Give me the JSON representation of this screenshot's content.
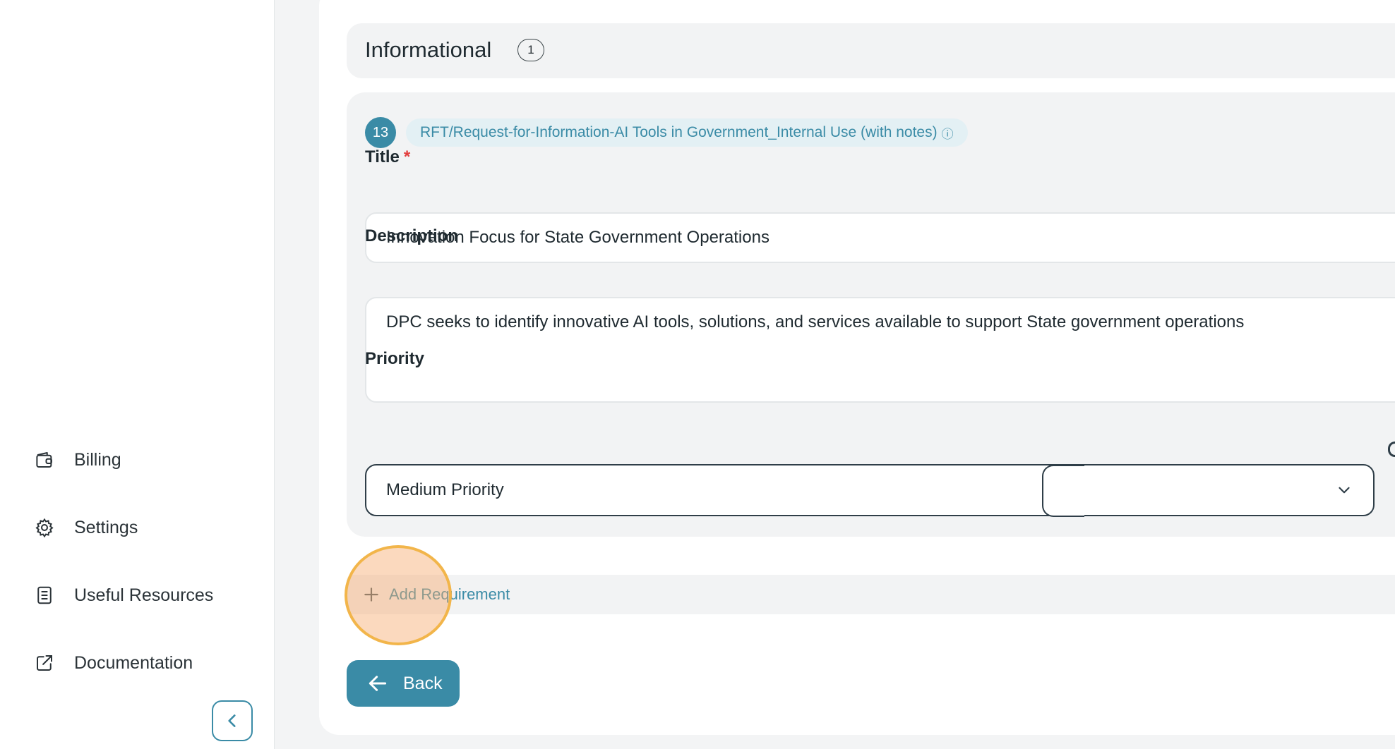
{
  "sidebar": {
    "items": [
      {
        "label": "Billing",
        "icon": "wallet-icon"
      },
      {
        "label": "Settings",
        "icon": "gear-icon"
      },
      {
        "label": "Useful Resources",
        "icon": "document-icon"
      },
      {
        "label": "Documentation",
        "icon": "external-link-icon"
      }
    ],
    "collapse_icon": "chevron-left-icon"
  },
  "group": {
    "title": "Informational",
    "count": "1"
  },
  "requirement": {
    "number": "13",
    "source": "RFT/Request-for-Information-AI Tools in Government_Internal Use (with notes)",
    "source_info_icon": "ⓘ",
    "title_label": "Title",
    "required_mark": "*",
    "title_value": "Innovation Focus for State Government Operations",
    "description_label": "Description",
    "description_value": "DPC seeks to identify innovative AI tools, solutions, and services available to support State government operations",
    "priority_label": "Priority",
    "priority_value": "Medium Priority"
  },
  "actions": {
    "add_requirement": "Add Requirement",
    "back": "Back"
  },
  "colors": {
    "accent": "#3a8ba6",
    "required": "#e23c3c",
    "highlight": "#f2b54a"
  }
}
